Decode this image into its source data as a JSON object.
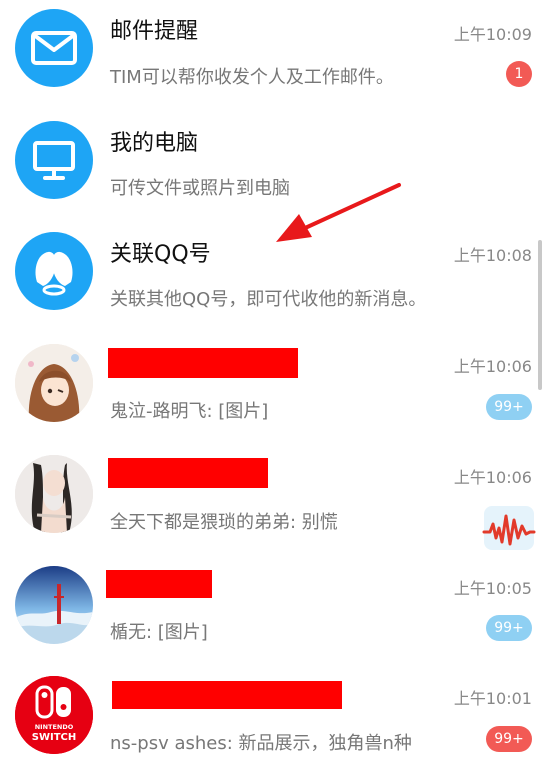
{
  "conversations": [
    {
      "name": "邮件提醒",
      "preview": "TIM可以帮你收发个人及工作邮件。",
      "time": "上午10:09",
      "badge": "1",
      "avatar_icon": "mail-icon"
    },
    {
      "name": "我的电脑",
      "preview": "可传文件或照片到电脑",
      "time": "",
      "badge": "",
      "avatar_icon": "monitor-icon"
    },
    {
      "name": "关联QQ号",
      "preview": "关联其他QQ号，即可代收他的新消息。",
      "time": "上午10:08",
      "badge": "",
      "avatar_icon": "linked-qq-icon"
    },
    {
      "name": "",
      "preview": "鬼泣-路明飞: [图片]",
      "time": "上午10:06",
      "badge": "99+",
      "avatar_icon": "anime-girl-avatar"
    },
    {
      "name": "",
      "preview": "全天下都是猥琐的弟弟: 别慌",
      "time": "上午10:06",
      "badge": "",
      "avatar_icon": "anime-figure-avatar"
    },
    {
      "name": "",
      "preview": "楯无: [图片]",
      "time": "上午10:05",
      "badge": "99+",
      "avatar_icon": "landscape-avatar"
    },
    {
      "name": "",
      "preview": "ns-psv ashes: 新品展示，独角兽n种",
      "time": "上午10:01",
      "badge": "99+",
      "avatar_icon": "nintendo-switch-logo"
    }
  ],
  "logo_text": {
    "nintendo": "NINTENDO",
    "switch": "SWITCH"
  },
  "colors": {
    "accent_blue": "#1ea5f5",
    "badge_red": "#f25a55",
    "badge_light_blue": "#8fd0f3",
    "redaction_red": "#ff0000",
    "arrow_red": "#e8191b"
  }
}
